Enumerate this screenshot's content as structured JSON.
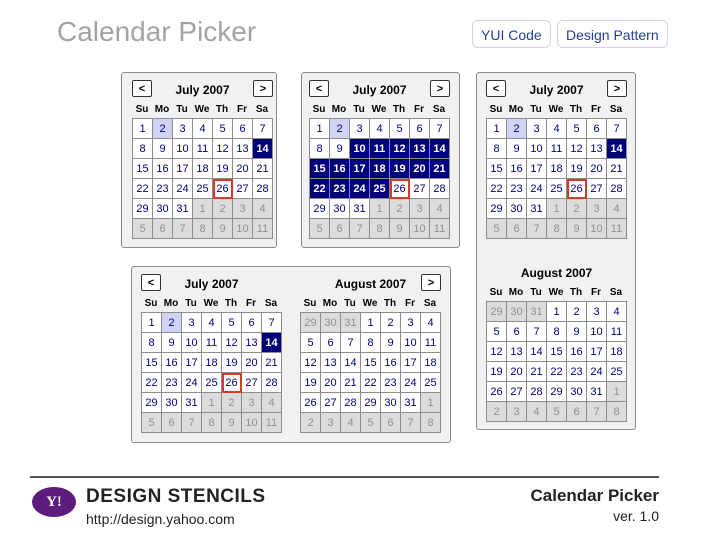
{
  "page": {
    "title": "Calendar Picker"
  },
  "top_links": {
    "yui_code": "YUI Code",
    "design_pattern": "Design Pattern"
  },
  "footer": {
    "logo_text": "Y!",
    "brand": "DESIGN STENCILS",
    "url": "http://design.yahoo.com",
    "title": "Calendar Picker",
    "version": "ver. 1.0"
  },
  "nav": {
    "prev": "<",
    "next": ">"
  },
  "weekdays": [
    "Su",
    "Mo",
    "Tu",
    "We",
    "Th",
    "Fr",
    "Sa"
  ],
  "months": {
    "july": {
      "title": "July 2007",
      "days": [
        "1",
        "2",
        "3",
        "4",
        "5",
        "6",
        "7",
        "8",
        "9",
        "10",
        "11",
        "12",
        "13",
        "14",
        "15",
        "16",
        "17",
        "18",
        "19",
        "20",
        "21",
        "22",
        "23",
        "24",
        "25",
        "26",
        "27",
        "28",
        "29",
        "30",
        "31",
        "1",
        "2",
        "3",
        "4",
        "5",
        "6",
        "7",
        "8",
        "9",
        "10",
        "11"
      ],
      "other_from": 31
    },
    "august": {
      "title": "August 2007",
      "days": [
        "29",
        "30",
        "31",
        "1",
        "2",
        "3",
        "4",
        "5",
        "6",
        "7",
        "8",
        "9",
        "10",
        "11",
        "12",
        "13",
        "14",
        "15",
        "16",
        "17",
        "18",
        "19",
        "20",
        "21",
        "22",
        "23",
        "24",
        "25",
        "26",
        "27",
        "28",
        "29",
        "30",
        "31",
        "1",
        "2",
        "3",
        "4",
        "5",
        "6",
        "7",
        "8"
      ],
      "other_before": 3,
      "other_from": 34
    }
  },
  "calendars": [
    {
      "name": "single-calendar-1",
      "month": "july",
      "selected": [
        13
      ],
      "highlight": [
        1
      ],
      "today": 25,
      "nav": [
        "prev",
        "next"
      ]
    },
    {
      "name": "single-calendar-range",
      "month": "july",
      "selected": [
        9,
        10,
        11,
        12,
        13,
        14,
        15,
        16,
        17,
        18,
        19,
        20,
        21,
        22,
        23,
        24
      ],
      "highlight": [
        1
      ],
      "today": 25,
      "nav": [
        "prev",
        "next"
      ]
    },
    {
      "name": "double-calendar-july",
      "month": "july",
      "selected": [
        13
      ],
      "highlight": [
        1
      ],
      "today": 25,
      "nav": [
        "prev"
      ]
    },
    {
      "name": "double-calendar-august",
      "month": "august",
      "selected": [],
      "highlight": [],
      "today": -1,
      "nav": [
        "next"
      ]
    },
    {
      "name": "vertical-calendar-july",
      "month": "july",
      "selected": [
        13
      ],
      "highlight": [
        1
      ],
      "today": 25,
      "nav": [
        "prev",
        "next"
      ]
    },
    {
      "name": "vertical-calendar-august",
      "month": "august",
      "selected": [],
      "highlight": [],
      "today": -1,
      "nav": []
    }
  ]
}
